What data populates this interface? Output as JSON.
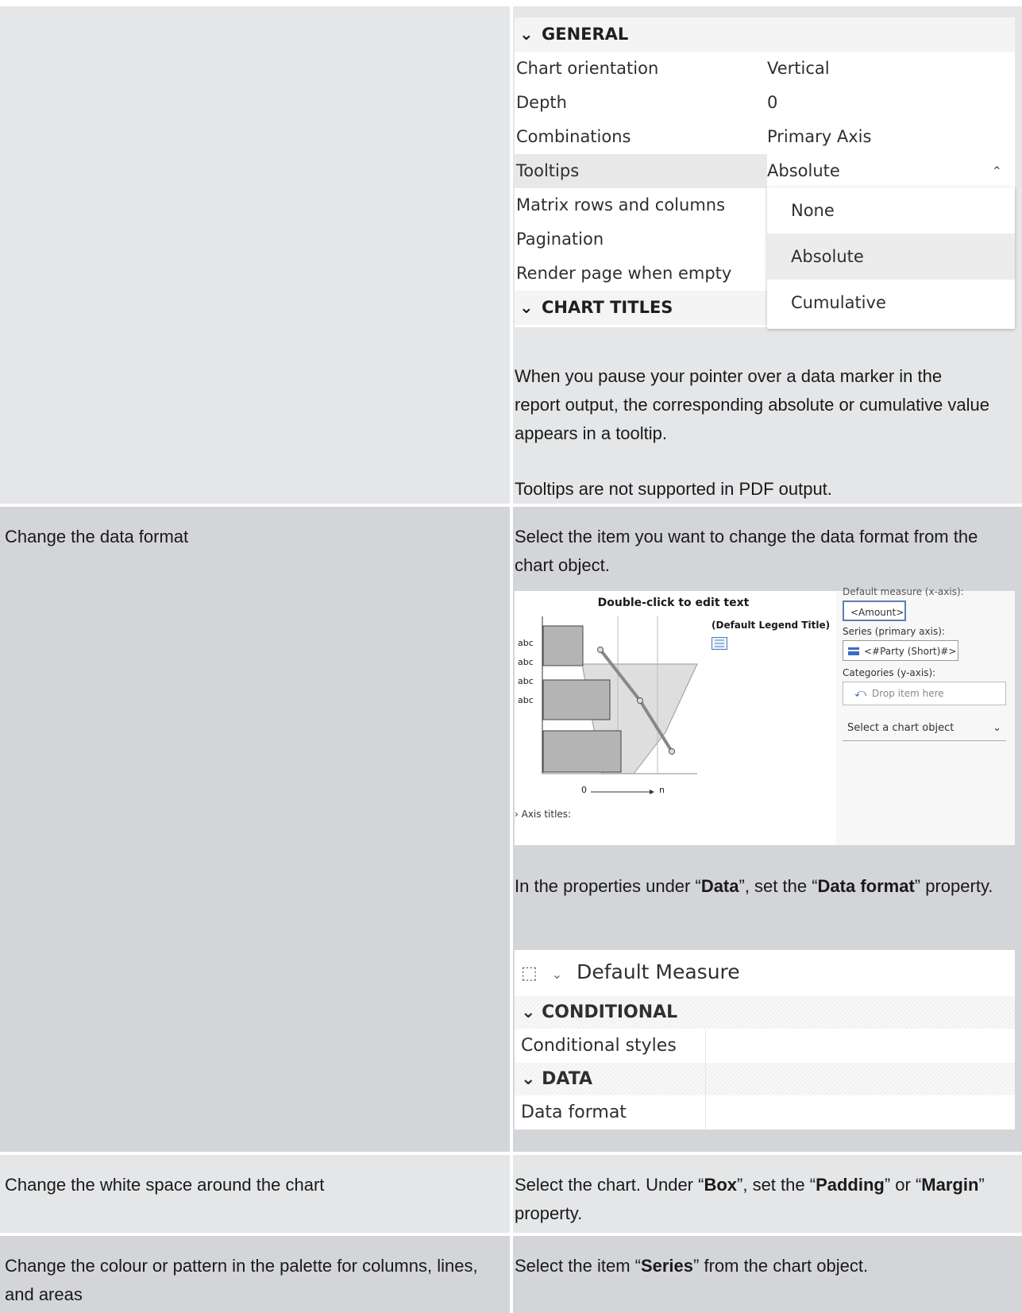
{
  "row1": {
    "panel": {
      "section_general": "GENERAL",
      "rows": [
        {
          "label": "Chart orientation",
          "value": "Vertical"
        },
        {
          "label": "Depth",
          "value": "0"
        },
        {
          "label": "Combinations",
          "value": "Primary Axis"
        },
        {
          "label": "Tooltips",
          "value": "Absolute"
        },
        {
          "label": "Matrix rows and columns",
          "value": ""
        },
        {
          "label": "Pagination",
          "value": ""
        },
        {
          "label": "Render page when empty",
          "value": ""
        }
      ],
      "section_chart_titles": "CHART TITLES",
      "dropdown_options": [
        "None",
        "Absolute",
        "Cumulative"
      ],
      "dropdown_selected": "Absolute"
    },
    "desc": "When you pause your pointer over a data marker in the report output, the corresponding absolute or cumulative value appears in a tooltip.",
    "note": "Tooltips are not supported in PDF output."
  },
  "row2": {
    "task": "Change the data format",
    "step1": "Select the item you want to change the data format from the chart object.",
    "chart": {
      "title": "Double-click to edit text",
      "legend_title": "(Default Legend Title)",
      "y_labels": [
        "abc",
        "abc",
        "abc",
        "abc"
      ],
      "x_start": "0",
      "x_end": "n",
      "axis_titles": "Axis titles:",
      "default_measure_label": "Default measure (x-axis):",
      "default_measure_value": "<Amount>",
      "series_label": "Series (primary axis):",
      "series_value": "<#Party (Short)#>",
      "categories_label": "Categories (y-axis):",
      "categories_value": "Drop item here",
      "select_object": "Select a chart object"
    },
    "step2_pre": "In the properties under “",
    "step2_b1": "Data",
    "step2_mid": "”, set the “",
    "step2_b2": "Data format",
    "step2_post": "” property.",
    "panel2": {
      "header": "Default Measure",
      "section_conditional": "CONDITIONAL",
      "conditional_styles": "Conditional styles",
      "section_data": "DATA",
      "data_format": "Data format"
    }
  },
  "row3": {
    "task": "Change the white space around the chart",
    "pre": "Select the chart. Under “",
    "b1": "Box",
    "mid": "”, set the “",
    "b2": "Padding",
    "mid2": "” or “",
    "b3": "Margin",
    "post": "” property."
  },
  "row4": {
    "task": "Change the colour or pattern in the palette for columns, lines, and areas",
    "pre": "Select the item “",
    "b1": "Series",
    "post": "” from the chart object."
  }
}
